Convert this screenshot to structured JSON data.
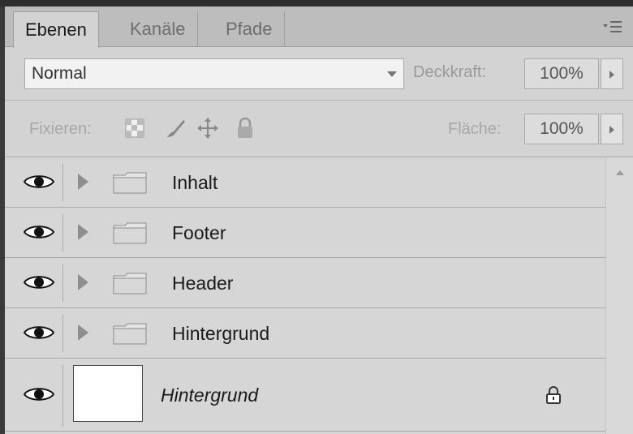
{
  "tabs": [
    {
      "label": "Ebenen",
      "active": true
    },
    {
      "label": "Kanäle",
      "active": false
    },
    {
      "label": "Pfade",
      "active": false
    }
  ],
  "blend": {
    "mode": "Normal",
    "opacity_label": "Deckkraft:",
    "opacity_value": "100%"
  },
  "lock": {
    "label": "Fixieren:",
    "icons": [
      "lock-transparent-pixels-icon",
      "lock-image-pixels-icon",
      "lock-position-icon",
      "lock-all-icon"
    ],
    "fill_label": "Fläche:",
    "fill_value": "100%"
  },
  "layers": [
    {
      "name": "Inhalt",
      "type": "group",
      "visible": true
    },
    {
      "name": "Footer",
      "type": "group",
      "visible": true
    },
    {
      "name": "Header",
      "type": "group",
      "visible": true
    },
    {
      "name": "Hintergrund",
      "type": "group",
      "visible": true
    },
    {
      "name": "Hintergrund",
      "type": "background",
      "visible": true,
      "locked": true
    }
  ],
  "colors": {
    "panel_bg": "#d3d3d3",
    "tab_bar_bg": "#bdbdbd",
    "row_border": "#a9a9a9"
  }
}
